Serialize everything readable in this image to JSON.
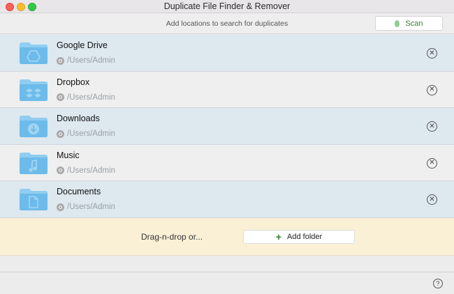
{
  "window": {
    "title": "Duplicate File Finder & Remover"
  },
  "toolbar": {
    "hint": "Add locations to search for duplicates",
    "scan_label": "Scan"
  },
  "locations": [
    {
      "name": "Google Drive",
      "path": "/Users/Admin",
      "icon": "google-drive-folder-icon"
    },
    {
      "name": "Dropbox",
      "path": "/Users/Admin",
      "icon": "dropbox-folder-icon"
    },
    {
      "name": "Downloads",
      "path": "/Users/Admin",
      "icon": "downloads-folder-icon"
    },
    {
      "name": "Music",
      "path": "/Users/Admin",
      "icon": "music-folder-icon"
    },
    {
      "name": "Documents",
      "path": "/Users/Admin",
      "icon": "documents-folder-icon"
    }
  ],
  "dropzone": {
    "text": "Drag-n-drop or...",
    "add_label": "Add folder"
  },
  "colors": {
    "accent_green": "#3a7d3a",
    "row_blue": "#dde8ef",
    "dropzone": "#faf0d6"
  }
}
